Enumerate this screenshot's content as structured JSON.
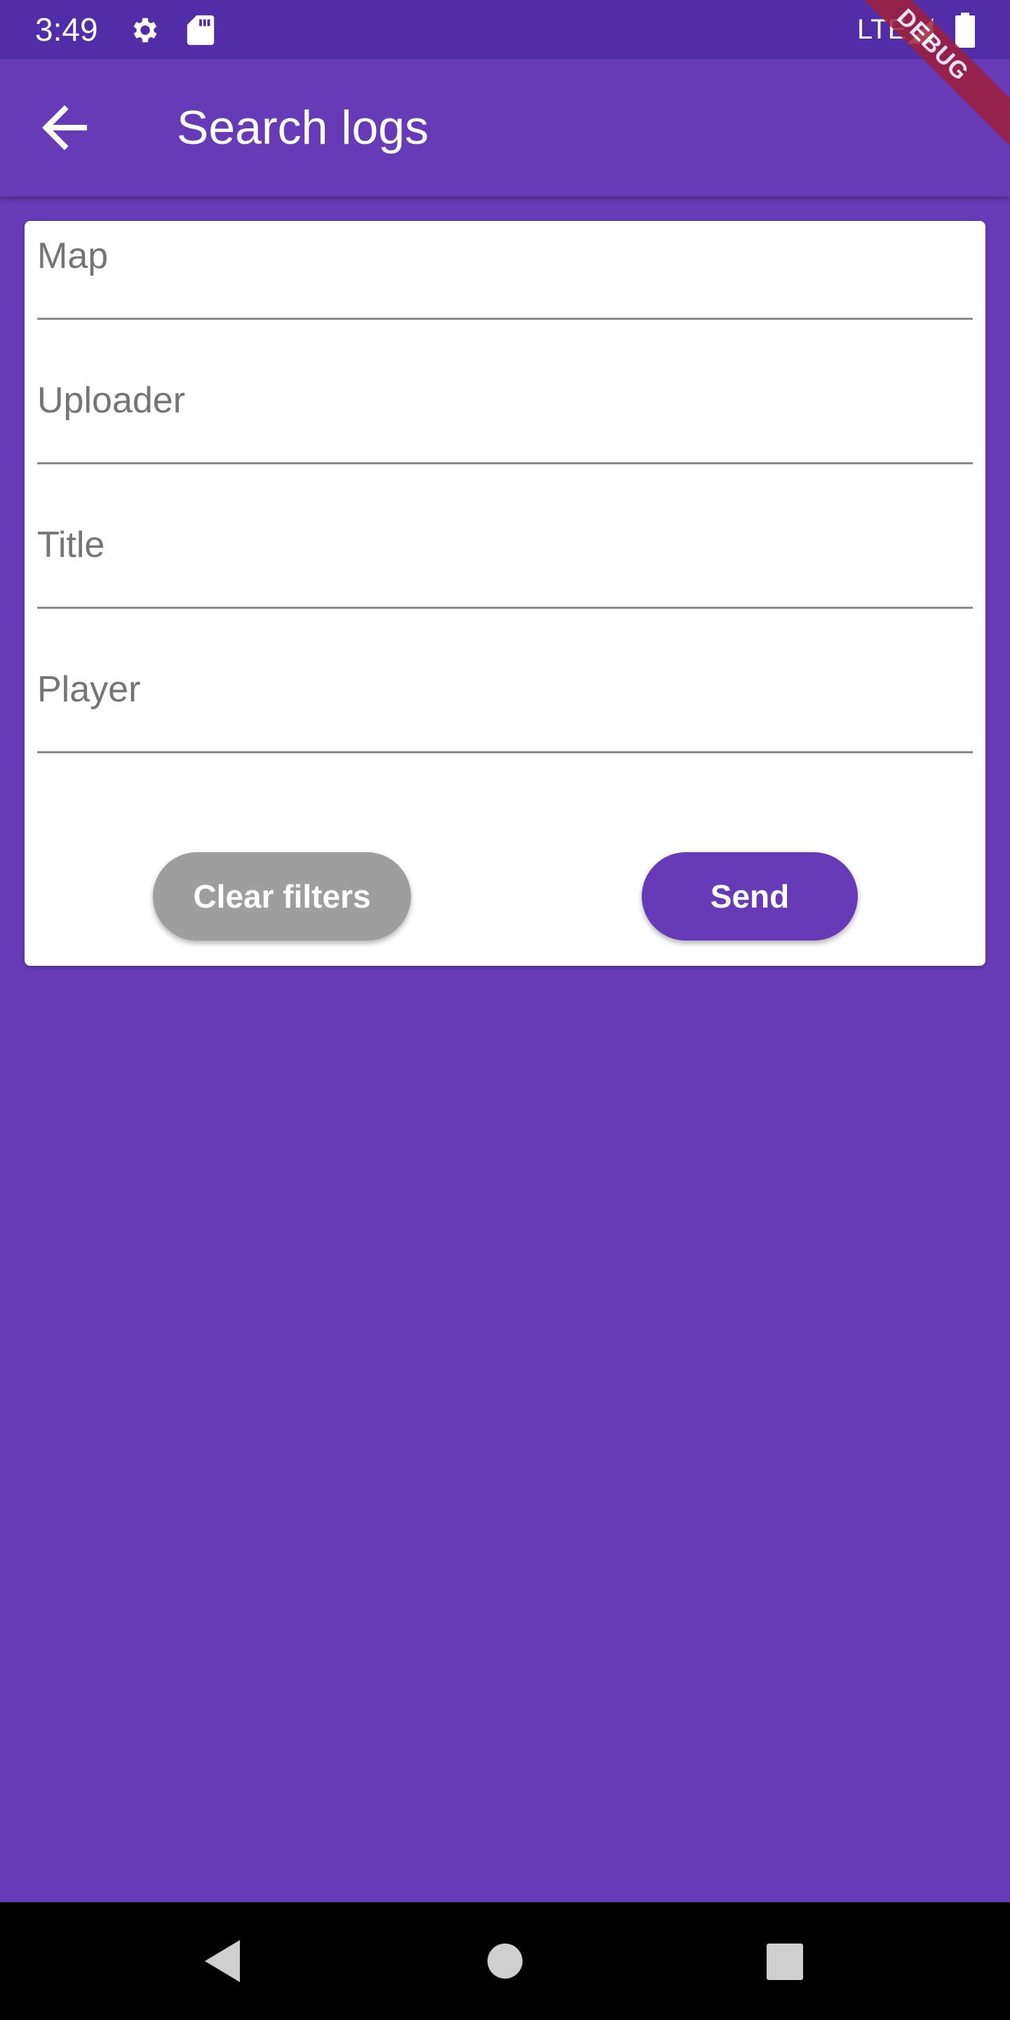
{
  "status_bar": {
    "time": "3:49",
    "network": "LTE",
    "icons": [
      "gear-icon",
      "sd-card-icon",
      "signal-icon",
      "battery-icon"
    ]
  },
  "app_bar": {
    "title": "Search logs",
    "back_icon": "arrow-back-icon"
  },
  "debug_banner": "DEBUG",
  "form": {
    "fields": [
      {
        "label": "Map",
        "value": ""
      },
      {
        "label": "Uploader",
        "value": ""
      },
      {
        "label": "Title",
        "value": ""
      },
      {
        "label": "Player",
        "value": ""
      }
    ],
    "clear_label": "Clear filters",
    "send_label": "Send"
  },
  "nav_bar": {
    "buttons": [
      "back-triangle-icon",
      "home-circle-icon",
      "recents-square-icon"
    ]
  },
  "colors": {
    "primary": "#673ab7",
    "status_bar": "#512da8",
    "clear_button": "#9e9e9e",
    "debug_ribbon": "#a01f3a"
  }
}
